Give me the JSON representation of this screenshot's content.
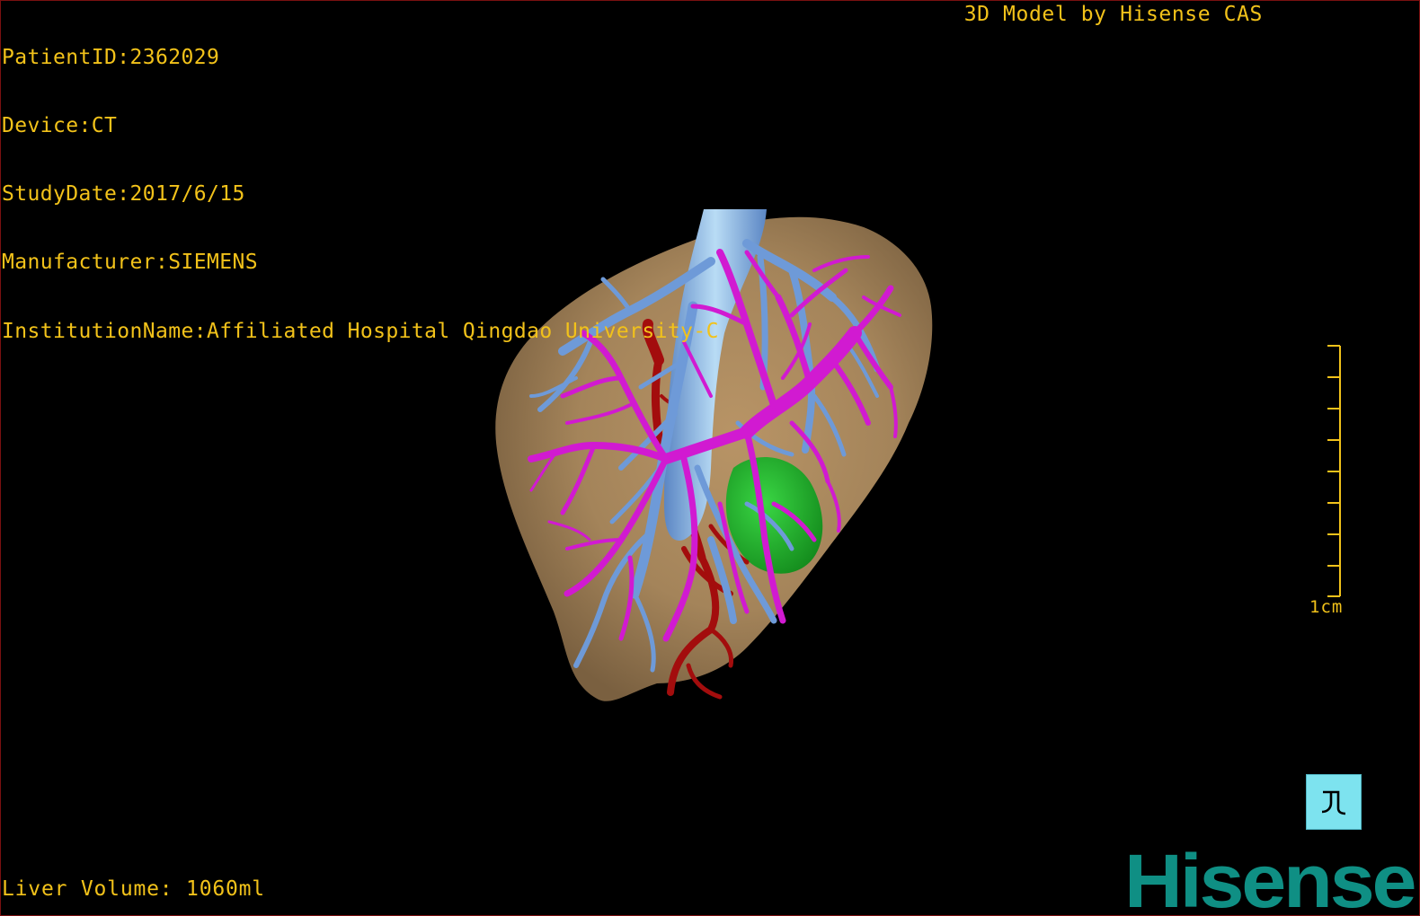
{
  "header": {
    "patient_id": "PatientID:2362029",
    "device": "Device:CT",
    "study_date": "StudyDate:2017/6/15",
    "manufacturer": "Manufacturer:SIEMENS",
    "institution": "InstitutionName:Affiliated Hospital Qingdao University-C"
  },
  "credit": "3D Model by Hisense CAS",
  "footer": {
    "liver_volume": "Liver Volume: 1060ml"
  },
  "scale_bar": {
    "label": "1cm"
  },
  "controls": {
    "reset_view_icon": "reset-view-icon"
  },
  "logo": {
    "text": "Hisense"
  },
  "colors": {
    "overlay_text": "#f2c21a",
    "liver": "#a8865a",
    "portal_vein": "#d11ad1",
    "hepatic_vein": "#6e9ad8",
    "artery": "#a30d0d",
    "gallbladder": "#21b02b",
    "button": "#7de3ef",
    "logo": "#0f8f84"
  }
}
